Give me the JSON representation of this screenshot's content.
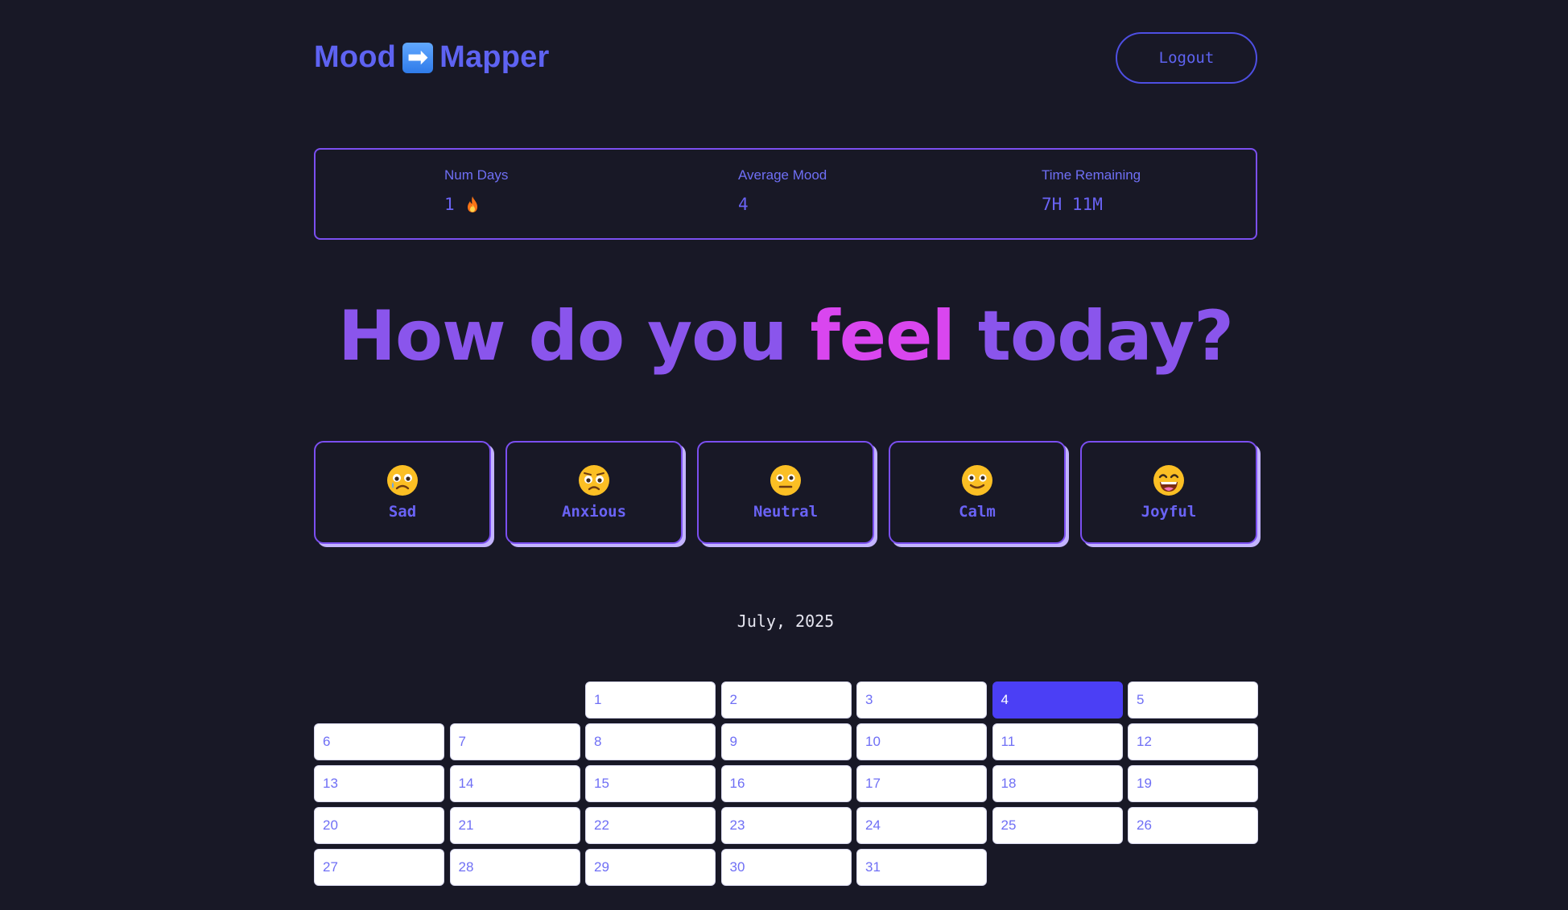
{
  "header": {
    "logo_left": "Mood",
    "logo_right": "Mapper",
    "logout_label": "Logout"
  },
  "stats": {
    "num_days_label": "Num Days",
    "num_days_value": "1",
    "average_mood_label": "Average Mood",
    "average_mood_value": "4",
    "time_remaining_label": "Time Remaining",
    "time_remaining_value": "7H 11M"
  },
  "headline": {
    "part1": "How do you ",
    "accent": "feel",
    "part2": " today?"
  },
  "moods": [
    {
      "label": "Sad",
      "icon": "crying-face-icon"
    },
    {
      "label": "Anxious",
      "icon": "worried-face-icon"
    },
    {
      "label": "Neutral",
      "icon": "neutral-face-icon"
    },
    {
      "label": "Calm",
      "icon": "slightly-smiling-face-icon"
    },
    {
      "label": "Joyful",
      "icon": "grinning-face-icon"
    }
  ],
  "calendar": {
    "month_label": "July, 2025",
    "first_weekday_index": 2,
    "days_in_month": 31,
    "selected_day": 4,
    "days": [
      "1",
      "2",
      "3",
      "4",
      "5",
      "6",
      "7",
      "8",
      "9",
      "10",
      "11",
      "12",
      "13",
      "14",
      "15",
      "16",
      "17",
      "18",
      "19",
      "20",
      "21",
      "22",
      "23",
      "24",
      "25",
      "26",
      "27",
      "28",
      "29",
      "30",
      "31"
    ]
  },
  "colors": {
    "background": "#181826",
    "accent_purple": "#8a55ec",
    "accent_pink": "#d946ef",
    "brand_indigo": "#5e63f2",
    "selected_day": "#4b3ff5"
  }
}
